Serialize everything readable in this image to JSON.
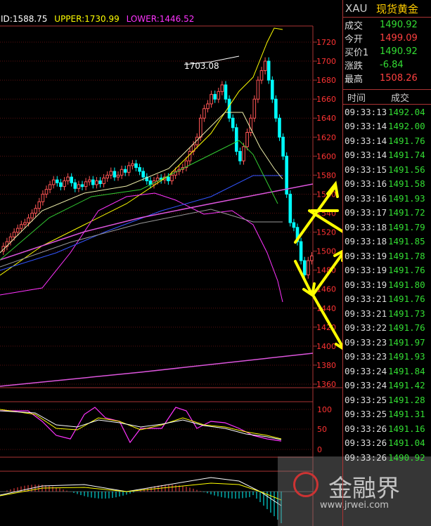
{
  "legend": {
    "mid": "ID:1588.75",
    "upper": "UPPER:1730.99",
    "lower": "LOWER:1446.52",
    "mid_color": "#ffffff",
    "upper_color": "#ffff00",
    "lower_color": "#ff33ff"
  },
  "chart": {
    "price_labels": [
      "1720",
      "1700",
      "1680",
      "1660",
      "1640",
      "1620",
      "1600",
      "1580",
      "1560",
      "1540",
      "1520",
      "1500",
      "1480",
      "1460",
      "1440",
      "1420",
      "1400",
      "1380",
      "1360"
    ],
    "peak_label": "1703.08",
    "kdj_labels": [
      "100",
      "50",
      "0"
    ],
    "watermark_text": "金融界",
    "watermark_url": "www.jrwei.com"
  },
  "quote": {
    "symbol": "XAU",
    "name": "现货黄金",
    "rows": [
      {
        "label": "成交",
        "value": "1490.92",
        "color": "dn"
      },
      {
        "label": "今开",
        "value": "1499.09",
        "color": "up"
      },
      {
        "label": "买价1",
        "value": "1490.92",
        "color": "dn"
      },
      {
        "label": "涨跌",
        "value": "-6.84",
        "color": "dn"
      },
      {
        "label": "最高",
        "value": "1508.26",
        "color": "up"
      }
    ]
  },
  "ticks": {
    "header_time": "时间",
    "header_price": "成交",
    "rows": [
      {
        "t": "09:33:13",
        "p": "1492.04"
      },
      {
        "t": "09:33:14",
        "p": "1492.00"
      },
      {
        "t": "09:33:14",
        "p": "1491.76"
      },
      {
        "t": "09:33:14",
        "p": "1491.74"
      },
      {
        "t": "09:33:15",
        "p": "1491.56"
      },
      {
        "t": "09:33:16",
        "p": "1491.58"
      },
      {
        "t": "09:33:16",
        "p": "1491.93"
      },
      {
        "t": "09:33:17",
        "p": "1491.72"
      },
      {
        "t": "09:33:18",
        "p": "1491.79"
      },
      {
        "t": "09:33:18",
        "p": "1491.85"
      },
      {
        "t": "09:33:19",
        "p": "1491.78"
      },
      {
        "t": "09:33:19",
        "p": "1491.76"
      },
      {
        "t": "09:33:19",
        "p": "1491.80"
      },
      {
        "t": "09:33:21",
        "p": "1491.76"
      },
      {
        "t": "09:33:21",
        "p": "1491.73"
      },
      {
        "t": "09:33:22",
        "p": "1491.76"
      },
      {
        "t": "09:33:23",
        "p": "1491.97"
      },
      {
        "t": "09:33:23",
        "p": "1491.93"
      },
      {
        "t": "09:33:24",
        "p": "1491.84"
      },
      {
        "t": "09:33:24",
        "p": "1491.42"
      },
      {
        "t": "09:33:25",
        "p": "1491.28"
      },
      {
        "t": "09:33:25",
        "p": "1491.31"
      },
      {
        "t": "09:33:26",
        "p": "1491.16"
      },
      {
        "t": "09:33:26",
        "p": "1491.04"
      },
      {
        "t": "09:33:26",
        "p": "1490.92"
      }
    ]
  }
}
